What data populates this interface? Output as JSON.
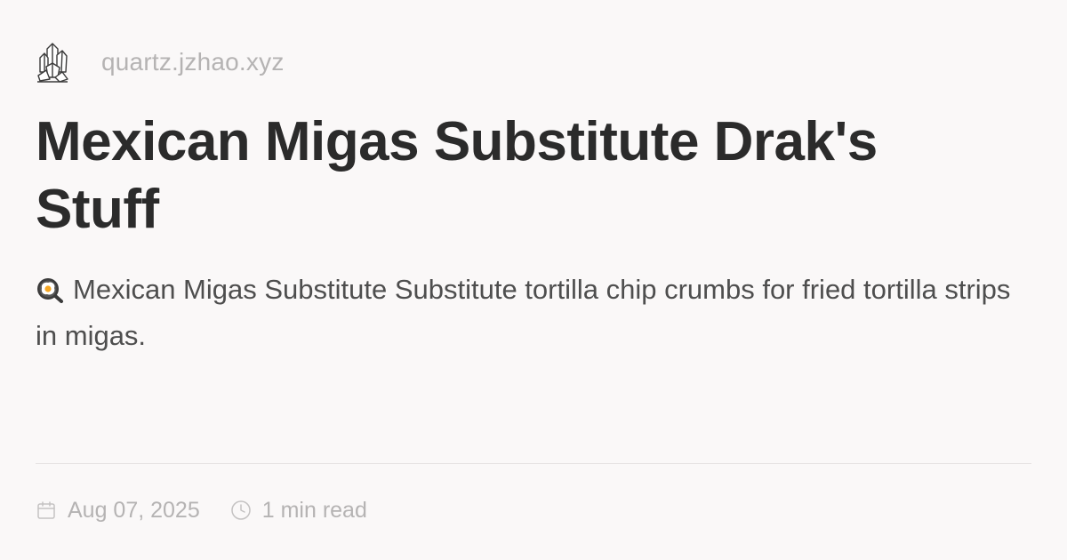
{
  "site": {
    "url": "quartz.jzhao.xyz",
    "logo_icon": "crystal-icon"
  },
  "page": {
    "title": "Mexican Migas Substitute Drak's Stuff",
    "description_emoji": "frying-pan-egg-icon",
    "description": "Mexican Migas Substitute Substitute tortilla chip crumbs for fried tortilla strips in migas."
  },
  "meta": {
    "date_icon": "calendar-icon",
    "date": "Aug 07, 2025",
    "read_time_icon": "clock-icon",
    "read_time": "1 min read"
  },
  "colors": {
    "background": "#faf8f8",
    "title": "#2b2b2b",
    "body_text": "#4e4e4e",
    "muted": "#b5b3b3",
    "divider": "#e6e3e3"
  }
}
